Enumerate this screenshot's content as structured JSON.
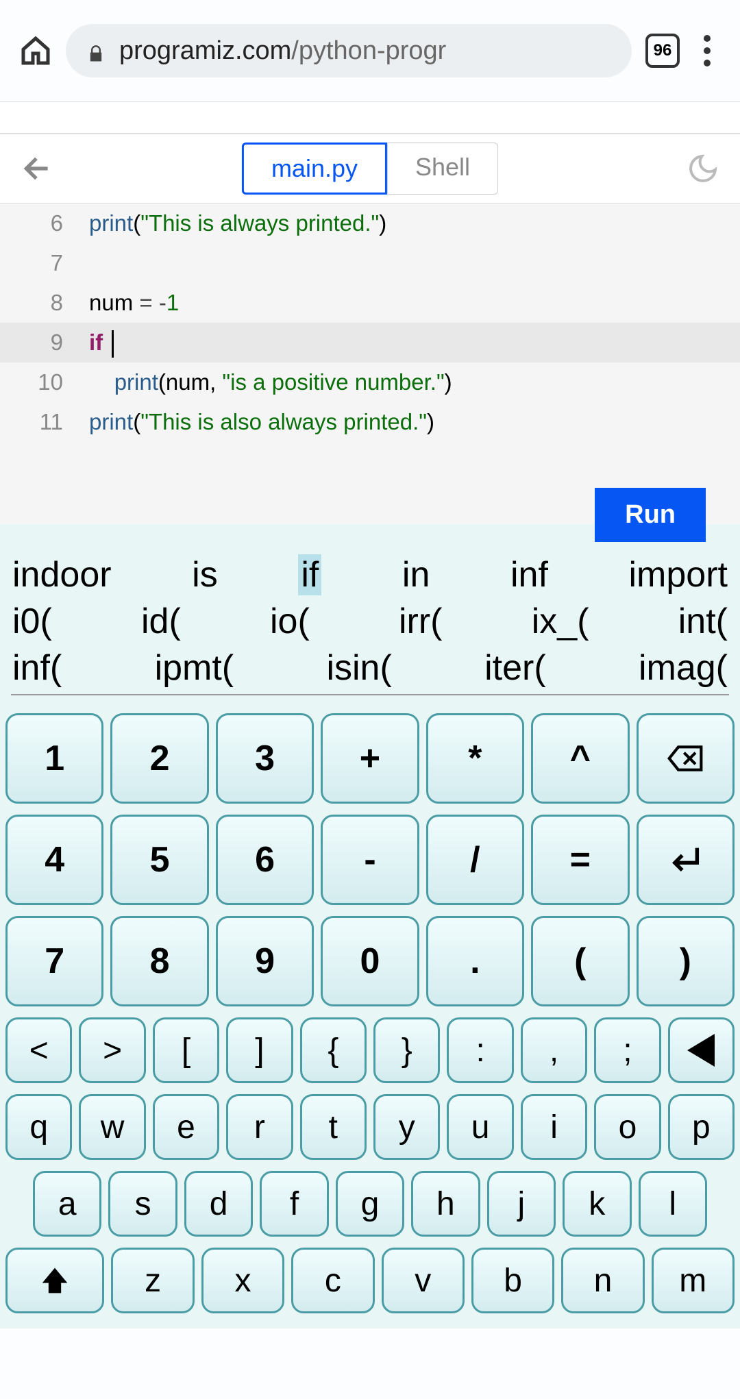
{
  "browser": {
    "tab_count": "96",
    "url_domain": "programiz.com",
    "url_path": "/python-progr"
  },
  "tabs": {
    "main": "main.py",
    "shell": "Shell"
  },
  "code": {
    "lines": [
      {
        "n": "6",
        "tokens": [
          {
            "t": "print",
            "c": "fn"
          },
          {
            "t": "(",
            "c": ""
          },
          {
            "t": "\"This is always printed.\"",
            "c": "str"
          },
          {
            "t": ")",
            "c": ""
          }
        ]
      },
      {
        "n": "7",
        "tokens": []
      },
      {
        "n": "8",
        "tokens": [
          {
            "t": "num ",
            "c": ""
          },
          {
            "t": "=",
            "c": "op"
          },
          {
            "t": " ",
            "c": ""
          },
          {
            "t": "-",
            "c": "op"
          },
          {
            "t": "1",
            "c": "num"
          }
        ]
      },
      {
        "n": "9",
        "tokens": [
          {
            "t": "if",
            "c": "kw"
          },
          {
            "t": " ",
            "c": ""
          }
        ],
        "cursor": true,
        "current": true
      },
      {
        "n": "10",
        "tokens": [
          {
            "t": "    ",
            "c": ""
          },
          {
            "t": "print",
            "c": "fn"
          },
          {
            "t": "(num, ",
            "c": ""
          },
          {
            "t": "\"is a positive number.\"",
            "c": "str"
          },
          {
            "t": ")",
            "c": ""
          }
        ]
      },
      {
        "n": "11",
        "tokens": [
          {
            "t": "print",
            "c": "fn"
          },
          {
            "t": "(",
            "c": ""
          },
          {
            "t": "\"This is also always printed.\"",
            "c": "str"
          },
          {
            "t": ")",
            "c": ""
          }
        ]
      }
    ],
    "run_label": "Run"
  },
  "suggestions": {
    "row1": [
      "indoor",
      "is",
      "if",
      "in",
      "inf",
      "import"
    ],
    "row1_highlight": 2,
    "row2": [
      "i0(",
      "id(",
      "io(",
      "irr(",
      "ix_(",
      "int("
    ],
    "row3": [
      "inf(",
      "ipmt(",
      "isin(",
      "iter(",
      "imag("
    ]
  },
  "keyboard": {
    "r1": [
      "1",
      "2",
      "3",
      "+",
      "*",
      "^"
    ],
    "r2": [
      "4",
      "5",
      "6",
      "-",
      "/",
      "="
    ],
    "r3": [
      "7",
      "8",
      "9",
      "0",
      ".",
      "(",
      ")"
    ],
    "r4": [
      "<",
      ">",
      "[",
      "]",
      "{",
      "}",
      ":",
      ",",
      ";"
    ],
    "r5": [
      "q",
      "w",
      "e",
      "r",
      "t",
      "y",
      "u",
      "i",
      "o",
      "p"
    ],
    "r6": [
      "a",
      "s",
      "d",
      "f",
      "g",
      "h",
      "j",
      "k",
      "l"
    ],
    "r7": [
      "z",
      "x",
      "c",
      "v",
      "b",
      "n",
      "m"
    ]
  }
}
